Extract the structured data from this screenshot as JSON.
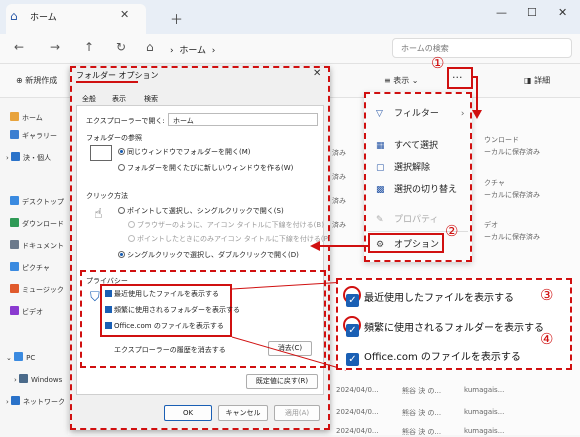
{
  "tab": {
    "title": "ホーム"
  },
  "address": {
    "crumb": "ホーム",
    "search_placeholder": "ホームの検索"
  },
  "toolbar": {
    "new": "新規作成",
    "display": "表示",
    "details": "詳細"
  },
  "sidebar": {
    "items": [
      "ホーム",
      "ギャラリー",
      "決・個人",
      "デスクトップ",
      "ダウンロード",
      "ドキュメント",
      "ピクチャ",
      "ミュージック",
      "ビデオ",
      "PC",
      "Windows",
      "ネットワーク"
    ]
  },
  "files": {
    "rows": [
      {
        "col1": "済み",
        "col2": "ウンロード",
        "col3": "ーカルに保存済み"
      },
      {
        "col1": "済み"
      },
      {
        "col1": "済み",
        "col2": "クチャ",
        "col3": "ーカルに保存済み"
      },
      {
        "col1": "済み",
        "col2": "デオ",
        "col3": "ーカルに保存済み"
      },
      {
        "col1": "2024/04/0...",
        "col2": "熊谷 決 の...",
        "col3": "kumagais..."
      },
      {
        "col1": "2024/04/0...",
        "col2": "熊谷 決 の...",
        "col3": "kumagais..."
      },
      {
        "col1": "2024/04/0...",
        "col2": "熊谷 決 の...",
        "col3": "kumagais..."
      }
    ]
  },
  "dialog": {
    "title": "フォルダー オプション",
    "tabs": [
      "全般",
      "表示",
      "検索"
    ],
    "open_label": "エクスプローラーで開く:",
    "open_value": "ホーム",
    "browse_heading": "フォルダーの参照",
    "browse_same": "同じウィンドウでフォルダーを開く(M)",
    "browse_new": "フォルダーを開くたびに新しいウィンドウを作る(W)",
    "click_heading": "クリック方法",
    "click_single": "ポイントして選択し、シングルクリックで開く(S)",
    "click_underline_browser": "ブラウザーのように、アイコン タイトルに下線を付ける(B)",
    "click_underline_point": "ポイントしたときにのみアイコン タイトルに下線を付ける(P)",
    "click_double": "シングルクリックで選択し、ダブルクリックで開く(D)",
    "privacy_heading": "プライバシー",
    "privacy": [
      "最近使用したファイルを表示する",
      "頻繁に使用されるフォルダーを表示する",
      "Office.com のファイルを表示する"
    ],
    "clear_label": "エクスプローラーの履歴を消去する",
    "clear_btn": "消去(C)",
    "restore_btn": "既定値に戻す(R)",
    "ok": "OK",
    "cancel": "キャンセル",
    "apply": "適用(A)"
  },
  "menu": {
    "items": [
      "フィルター",
      "すべて選択",
      "選択解除",
      "選択の切り替え",
      "プロパティ",
      "オプション"
    ]
  },
  "zoom": {
    "items": [
      "最近使用したファイルを表示する",
      "頻繁に使用されるフォルダーを表示する",
      "Office.com のファイルを表示する"
    ]
  },
  "annotations": {
    "n1": "①",
    "n2": "②",
    "n3": "③",
    "n4": "④"
  },
  "accent": "#1a5fb4",
  "annotation_color": "#d01010"
}
